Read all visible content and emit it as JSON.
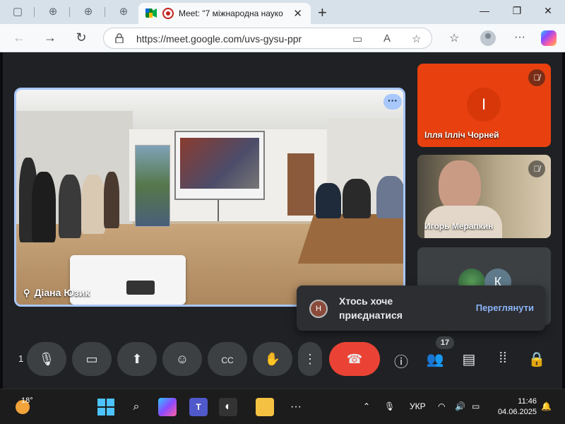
{
  "browser": {
    "tab_title": "Meet: \"7 міжнародна науко",
    "url": "https://meet.google.com/uvs-gysu-ppr"
  },
  "meeting": {
    "main_speaker_name": "Діана Юзик",
    "participants": [
      {
        "name": "Ілля Ілліч Чорней",
        "initial": "І",
        "muted": true
      },
      {
        "name": "Игорь Мерапкин",
        "muted": true
      }
    ],
    "overflow_avatar_letter": "К",
    "participant_count": "17",
    "left_number": "1"
  },
  "toast": {
    "avatar_letter": "Н",
    "message": "Хтось хоче приєднатися",
    "action": "Переглянути"
  },
  "taskbar": {
    "temperature": "18°",
    "language": "УКР",
    "time": "11:46",
    "date": "04.06.2025"
  },
  "colors": {
    "end_call": "#ea4335",
    "accent_blue": "#a8c7fa",
    "participant_orange": "#e8410f"
  }
}
